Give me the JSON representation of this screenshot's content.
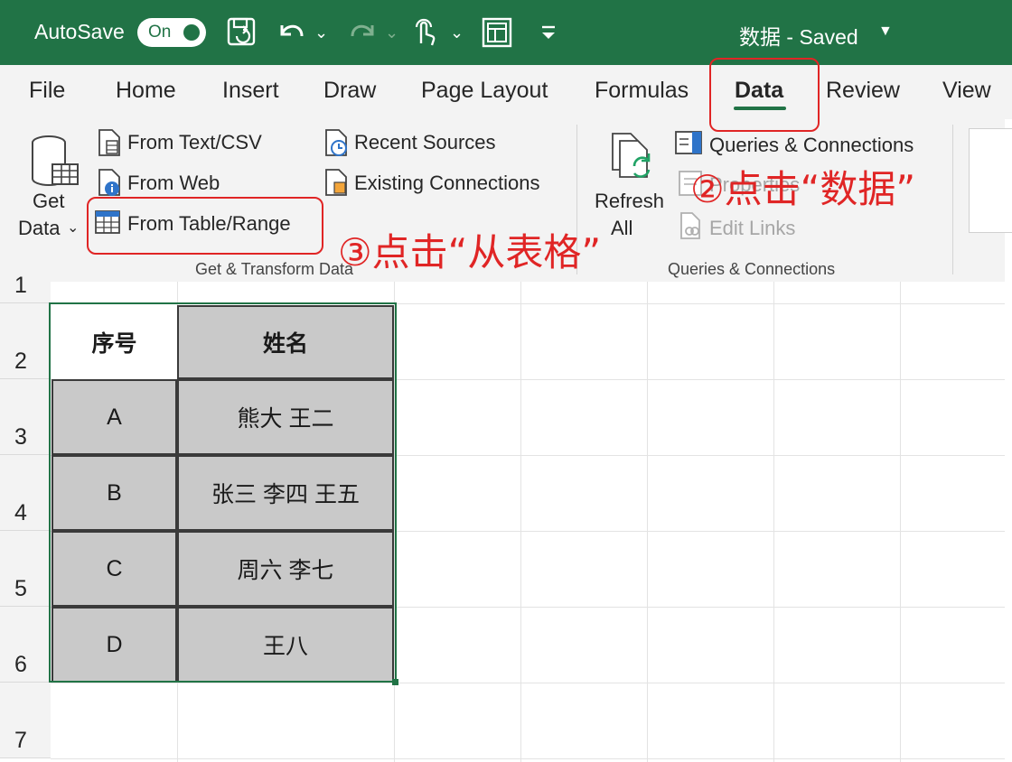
{
  "titlebar": {
    "autosave_label": "AutoSave",
    "autosave_state": "On",
    "file_title": "数据 - Saved",
    "icons": [
      "save-icon",
      "undo-icon",
      "redo-icon",
      "touch-mode-icon",
      "form-icon",
      "customize-qat-icon"
    ],
    "color": "#217346"
  },
  "tabs": [
    "File",
    "Home",
    "Insert",
    "Draw",
    "Page Layout",
    "Formulas",
    "Data",
    "Review",
    "View"
  ],
  "active_tab": "Data",
  "ribbon": {
    "get_data": {
      "line1": "Get",
      "line2": "Data"
    },
    "from_text_csv": "From Text/CSV",
    "from_web": "From Web",
    "from_table_range": "From Table/Range",
    "recent_sources": "Recent Sources",
    "existing_connections": "Existing Connections",
    "group_get_transform": "Get & Transform Data",
    "refresh_all": {
      "line1": "Refresh",
      "line2": "All"
    },
    "queries_connections": "Queries & Connections",
    "properties": "Properties",
    "edit_links": "Edit Links",
    "group_queries": "Queries & Connections"
  },
  "annotations": {
    "step2": "②点击“数据”",
    "step3": "③点击“从表格”",
    "color": "#e02525"
  },
  "grid": {
    "row_numbers": [
      "1",
      "2",
      "3",
      "4",
      "5",
      "6",
      "7"
    ],
    "headers": [
      "序号",
      "姓名"
    ],
    "rows": [
      {
        "id": "A",
        "names": "熊大 王二"
      },
      {
        "id": "B",
        "names": "张三 李四 王五"
      },
      {
        "id": "C",
        "names": "周六 李七"
      },
      {
        "id": "D",
        "names": "王八"
      }
    ]
  }
}
